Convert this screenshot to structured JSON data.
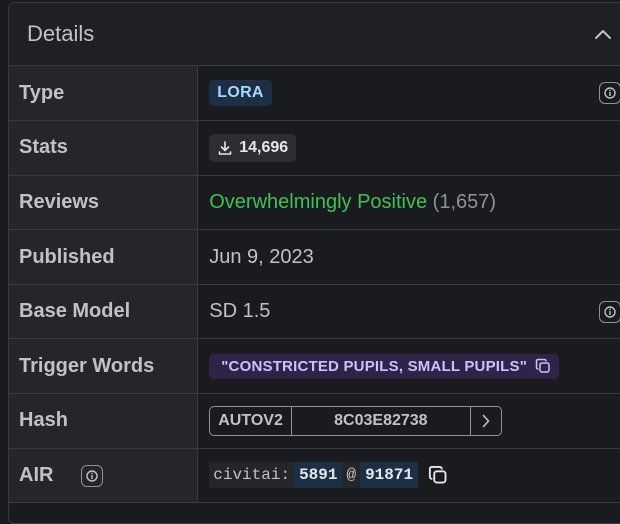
{
  "header": {
    "title": "Details"
  },
  "rows": {
    "type": {
      "label": "Type",
      "badge": "LORA"
    },
    "stats": {
      "label": "Stats",
      "downloads": "14,696"
    },
    "reviews": {
      "label": "Reviews",
      "rating": "Overwhelmingly Positive",
      "count": "(1,657)"
    },
    "published": {
      "label": "Published",
      "date": "Jun 9, 2023"
    },
    "base_model": {
      "label": "Base Model",
      "value": "SD 1.5"
    },
    "trigger": {
      "label": "Trigger Words",
      "words": "\"CONSTRICTED PUPILS, SMALL PUPILS\""
    },
    "hash": {
      "label": "Hash",
      "algo": "AUTOV2",
      "value": "8C03E82738"
    },
    "air": {
      "label": "AIR",
      "prefix": "civitai:",
      "model_id": "5891",
      "at": "@",
      "version_id": "91871"
    }
  },
  "colors": {
    "accent_green": "#40c057",
    "badge_blue": "#a5d8ff",
    "trigger_purple": "#d0bfff"
  }
}
